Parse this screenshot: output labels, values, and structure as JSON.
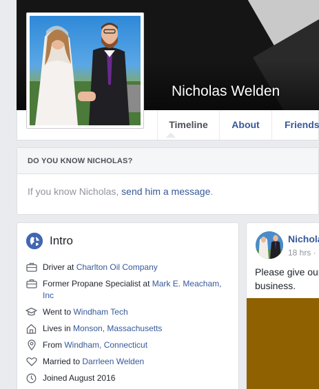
{
  "profile": {
    "name": "Nicholas Welden"
  },
  "nav": {
    "tabs": [
      {
        "label": "Timeline"
      },
      {
        "label": "About"
      },
      {
        "label": "Friends"
      }
    ]
  },
  "know": {
    "heading": "DO YOU KNOW NICHOLAS?",
    "prefix": "If you know Nicholas, ",
    "link": "send him a message",
    "suffix": "."
  },
  "intro": {
    "title": "Intro",
    "items": [
      {
        "icon": "briefcase-icon",
        "text": "Driver at ",
        "link": "Charlton Oil Company"
      },
      {
        "icon": "briefcase-icon",
        "text": "Former Propane Specialist at ",
        "link": "Mark E. Meacham, Inc"
      },
      {
        "icon": "graduation-cap-icon",
        "text": "Went to ",
        "link": "Windham Tech"
      },
      {
        "icon": "house-icon",
        "text": "Lives in ",
        "link": "Monson, Massachusetts"
      },
      {
        "icon": "location-pin-icon",
        "text": "From ",
        "link": "Windham, Connecticut"
      },
      {
        "icon": "heart-icon",
        "text": "Married to ",
        "link": "Darrleen Welden"
      },
      {
        "icon": "clock-icon",
        "text": "Joined August 2016",
        "link": ""
      }
    ]
  },
  "post": {
    "author": "Nicholas Welden",
    "time": "18 hrs · ",
    "text": "Please give our business."
  },
  "colors": {
    "link": "#365899",
    "background": "#e9ebee",
    "post_image": "#8f6100"
  }
}
